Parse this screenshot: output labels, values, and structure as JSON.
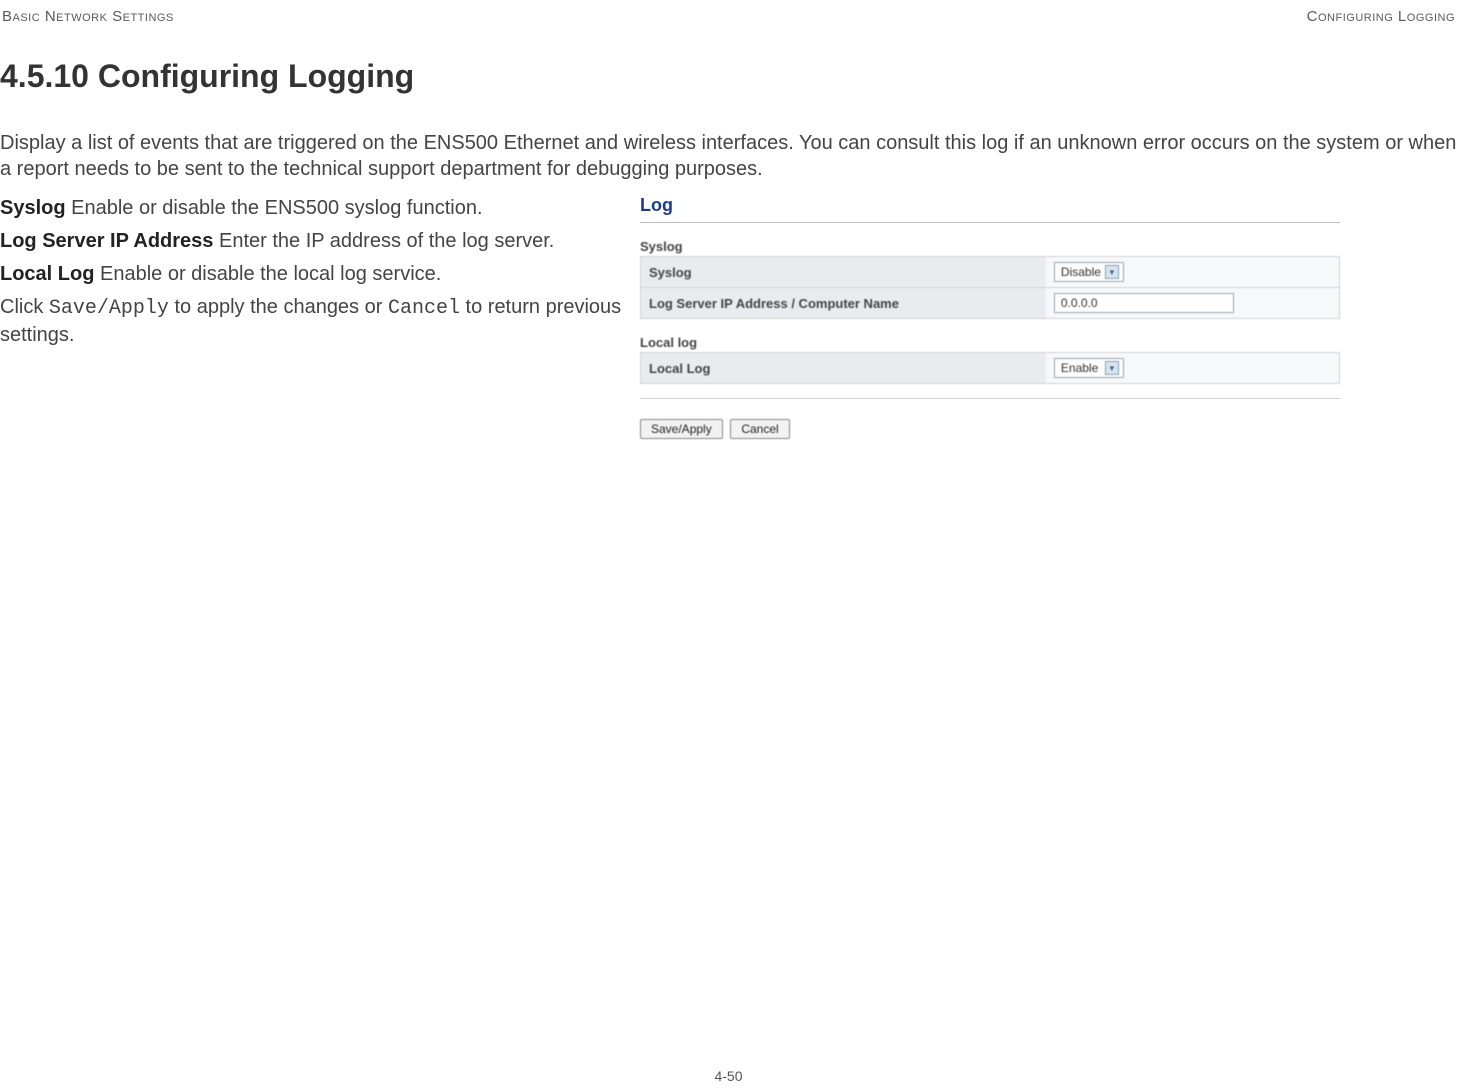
{
  "header": {
    "left": "Basic Network Settings",
    "right": "Configuring Logging"
  },
  "heading": "4.5.10 Configuring Logging",
  "intro": "Display a list of events that are triggered on the ENS500 Ethernet and wireless interfaces. You can consult this log if an unknown error occurs on the system or when a report needs to be sent to the technical support department for debugging purposes.",
  "definitions": {
    "syslog": {
      "term": "Syslog",
      "desc": "  Enable or disable the ENS500 syslog function."
    },
    "logserver": {
      "term": "Log Server IP Address",
      "desc": "  Enter the IP address of the log server."
    },
    "locallog": {
      "term": "Local Log",
      "desc": "  Enable or disable the local log service."
    },
    "action": {
      "pre": "Click ",
      "save": "Save/Apply",
      "mid": " to apply the changes or ",
      "cancel": "Cancel",
      "post": " to return previous settings."
    }
  },
  "screenshot": {
    "title": "Log",
    "syslog": {
      "heading": "Syslog",
      "rows": {
        "syslog": {
          "label": "Syslog",
          "value": "Disable"
        },
        "ip": {
          "label": "Log Server IP Address / Computer Name",
          "value": "0.0.0.0"
        }
      }
    },
    "locallog": {
      "heading": "Local log",
      "rows": {
        "local": {
          "label": "Local Log",
          "value": "Enable"
        }
      }
    },
    "buttons": {
      "save": "Save/Apply",
      "cancel": "Cancel"
    }
  },
  "page_number": "4-50"
}
